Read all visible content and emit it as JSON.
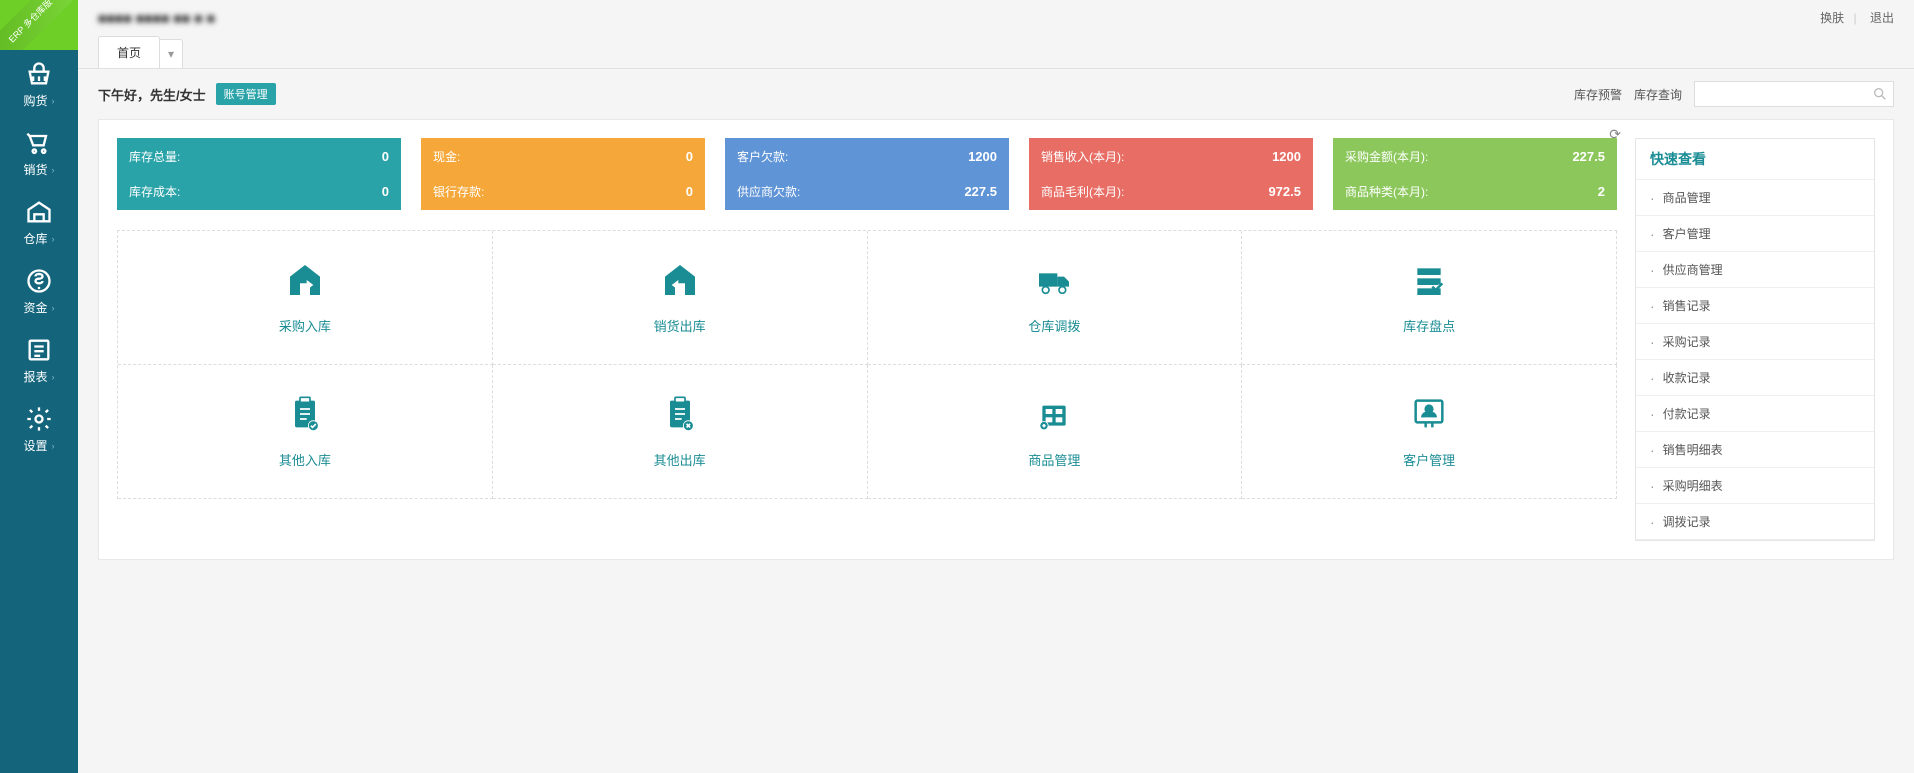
{
  "corner": "ERP\n多仓库版",
  "header": {
    "blurred_title": "■■■■ ■■■■ ■■ ■ ■",
    "skin_link": "换肤",
    "logout_link": "退出"
  },
  "tabs": {
    "home": "首页"
  },
  "subheader": {
    "greeting": "下午好，先生/女士",
    "account_btn": "账号管理",
    "stock_warning": "库存预警",
    "stock_query": "库存查询",
    "search_placeholder": ""
  },
  "stats": [
    {
      "color": "c-teal",
      "label1": "库存总量:",
      "val1": "0",
      "label2": "库存成本:",
      "val2": "0"
    },
    {
      "color": "c-orange",
      "label1": "现金:",
      "val1": "0",
      "label2": "银行存款:",
      "val2": "0"
    },
    {
      "color": "c-blue",
      "label1": "客户欠款:",
      "val1": "1200",
      "label2": "供应商欠款:",
      "val2": "227.5"
    },
    {
      "color": "c-red",
      "label1": "销售收入(本月):",
      "val1": "1200",
      "label2": "商品毛利(本月):",
      "val2": "972.5"
    },
    {
      "color": "c-green",
      "label1": "采购金额(本月):",
      "val1": "227.5",
      "label2": "商品种类(本月):",
      "val2": "2"
    }
  ],
  "sidebar": {
    "items": [
      {
        "label": "购货"
      },
      {
        "label": "销货"
      },
      {
        "label": "仓库"
      },
      {
        "label": "资金"
      },
      {
        "label": "报表"
      },
      {
        "label": "设置"
      }
    ]
  },
  "actions": [
    {
      "label": "采购入库",
      "icon": "house-in"
    },
    {
      "label": "销货出库",
      "icon": "house-out"
    },
    {
      "label": "仓库调拨",
      "icon": "truck"
    },
    {
      "label": "库存盘点",
      "icon": "inventory"
    },
    {
      "label": "其他入库",
      "icon": "clipboard-in"
    },
    {
      "label": "其他出库",
      "icon": "clipboard-out"
    },
    {
      "label": "商品管理",
      "icon": "goods"
    },
    {
      "label": "客户管理",
      "icon": "customer"
    }
  ],
  "quick": {
    "title": "快速查看",
    "items": [
      "商品管理",
      "客户管理",
      "供应商管理",
      "销售记录",
      "采购记录",
      "收款记录",
      "付款记录",
      "销售明细表",
      "采购明细表",
      "调拨记录"
    ]
  }
}
